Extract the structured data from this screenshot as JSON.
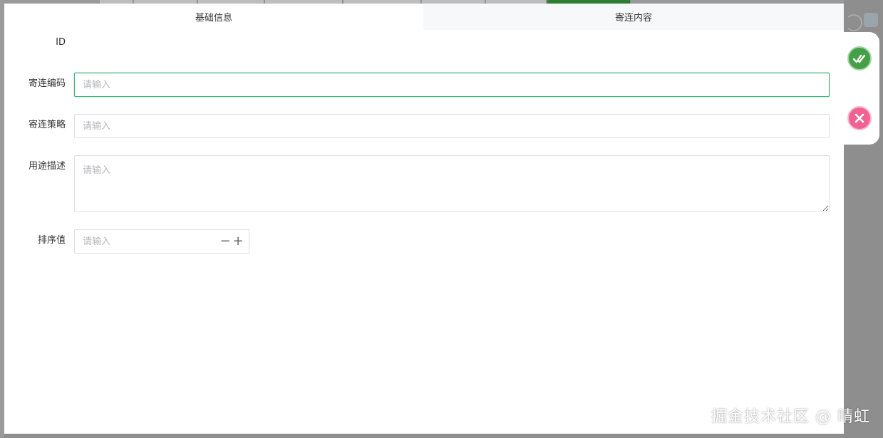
{
  "dialog": {
    "tabs": [
      {
        "label": "基础信息",
        "active": true
      },
      {
        "label": "寄连内容",
        "active": false
      }
    ],
    "form": {
      "id_label": "ID",
      "code_label": "寄连编码",
      "code_placeholder": "请输入",
      "strategy_label": "寄连策略",
      "strategy_placeholder": "请输入",
      "description_label": "用途描述",
      "description_placeholder": "请输入",
      "sort_label": "排序值",
      "sort_placeholder": "请输入",
      "sort_minus": "−",
      "sort_plus": "+"
    }
  },
  "actions": {
    "confirm_icon": "double-check-icon",
    "cancel_icon": "close-icon",
    "confirm_color": "#43a047",
    "cancel_color": "#f06292"
  },
  "watermark": "掘金技术社区 @ 晴虹",
  "colors": {
    "focus_border": "#3fb37f",
    "inactive_tab_bg": "#f7f8fa"
  }
}
